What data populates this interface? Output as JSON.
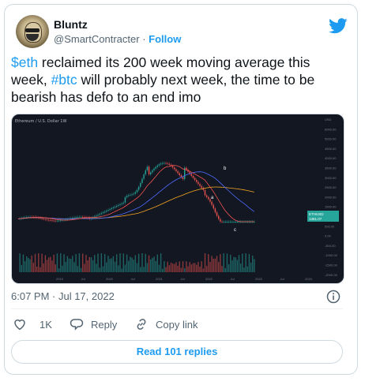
{
  "tweet": {
    "author": {
      "name": "Bluntz",
      "handle": "@SmartContracter",
      "separator": "·",
      "follow_label": "Follow"
    },
    "text": {
      "cashtag": "$eth",
      "part1": " reclaimed its 200 week moving average this week, ",
      "hashtag": "#btc",
      "part2": " will probably next week, the time to be bearish has defo to an end imo"
    },
    "timestamp": "6:07 PM · Jul 17, 2022",
    "likes": {
      "count": "1K"
    },
    "reply_label": "Reply",
    "copy_link_label": "Copy link",
    "read_replies_label": "Read 101 replies"
  },
  "chart_image": {
    "header": "Ethereum / U.S. Dollar  1W",
    "price_tag": "ETHUSD",
    "price_value": "1361.07",
    "x_labels": [
      "2019",
      "Jul",
      "2020",
      "Jul",
      "2021",
      "Jul",
      "2022",
      "Jul",
      "2023",
      "Jul",
      "2024"
    ],
    "y_labels": [
      "USD",
      "6000.00",
      "5000.00",
      "4500.00",
      "4000.00",
      "3500.00",
      "3000.00",
      "2500.00",
      "2000.00",
      "1500.00",
      "1000.00",
      "500.00",
      "0.00",
      "-500.00",
      "-1000.00",
      "-1500.00",
      "-2000.00"
    ],
    "wave_labels": [
      "a",
      "b",
      "c"
    ],
    "colors": {
      "background": "#131722",
      "up": "#26a69a",
      "down": "#ef5350",
      "ma_long": "#f5a623",
      "ma_mid": "#4d6bff"
    }
  },
  "colors": {
    "accent": "#1d9bf0",
    "text": "#0f1419",
    "secondary": "#536471"
  }
}
